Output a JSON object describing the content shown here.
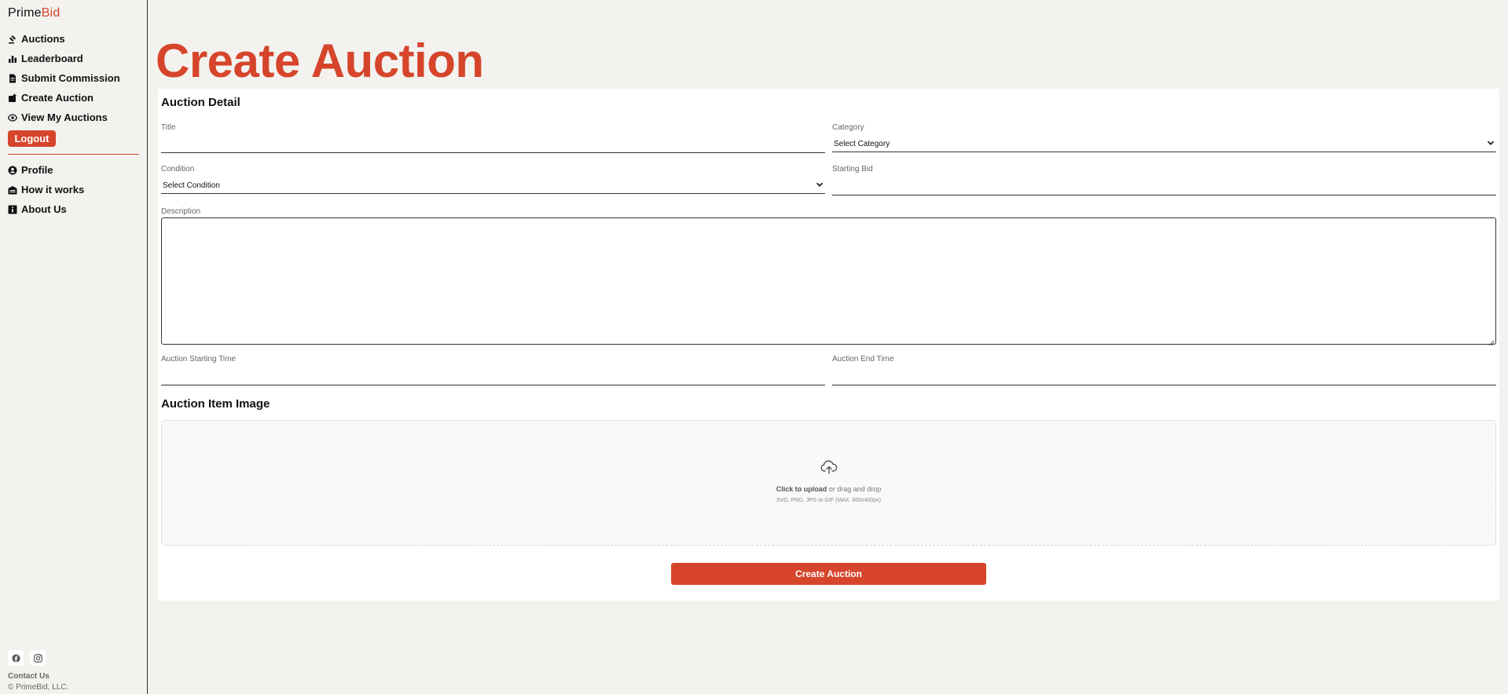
{
  "brand": {
    "name_part1": "Prime",
    "name_part2": "Bid",
    "accent_color": "#d6452b"
  },
  "sidebar": {
    "items": [
      {
        "label": "Auctions",
        "icon": "gavel-icon"
      },
      {
        "label": "Leaderboard",
        "icon": "bar-chart-icon"
      },
      {
        "label": "Submit Commission",
        "icon": "document-icon"
      },
      {
        "label": "Create Auction",
        "icon": "box-plus-icon"
      },
      {
        "label": "View My Auctions",
        "icon": "eye-icon"
      }
    ],
    "logout_label": "Logout",
    "secondary_items": [
      {
        "label": "Profile",
        "icon": "user-circle-icon"
      },
      {
        "label": "How it works",
        "icon": "garage-icon"
      },
      {
        "label": "About Us",
        "icon": "info-icon"
      }
    ],
    "social": [
      "facebook-icon",
      "instagram-icon"
    ],
    "contact_label": "Contact Us",
    "copyright": "© PrimeBid, LLC."
  },
  "page": {
    "title": "Create Auction",
    "detail_heading": "Auction Detail",
    "fields": {
      "title_label": "Title",
      "title_value": "",
      "category_label": "Category",
      "category_value": "Select Category",
      "condition_label": "Condition",
      "condition_value": "Select Condition",
      "starting_bid_label": "Starting Bid",
      "starting_bid_value": "",
      "description_label": "Description",
      "description_value": "",
      "start_time_label": "Auction Starting Time",
      "end_time_label": "Auction End Time"
    },
    "image_heading": "Auction Item Image",
    "upload": {
      "click_text": "Click to upload",
      "drag_text": " or drag and drop",
      "hint": "SVG, PNG, JPG or GIF (MAX. 800x400px)"
    },
    "submit_label": "Create Auction"
  }
}
